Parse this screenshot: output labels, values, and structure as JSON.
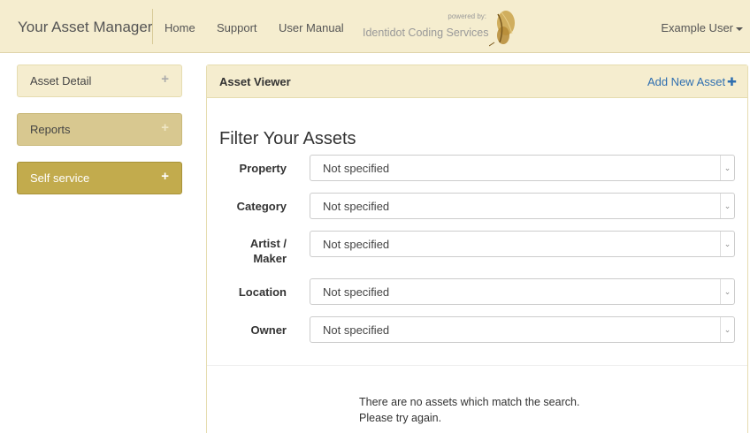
{
  "navbar": {
    "brand": "Your Asset Manager",
    "links": [
      "Home",
      "Support",
      "User Manual"
    ],
    "powered_by": "powered by:",
    "powered_name": "Identidot Coding Services",
    "user": "Example User"
  },
  "sidebar": {
    "items": [
      {
        "label": "Asset Detail",
        "icon": "plus-icon"
      },
      {
        "label": "Reports",
        "icon": "plus-icon"
      },
      {
        "label": "Self service",
        "icon": "plus-icon"
      }
    ]
  },
  "main": {
    "title": "Asset Viewer",
    "add_label": "Add New Asset",
    "filter_title": "Filter Your Assets",
    "filters": [
      {
        "label": "Property",
        "value": "Not specified"
      },
      {
        "label": "Category",
        "value": "Not specified"
      },
      {
        "label": "Artist /\nMaker",
        "value": "Not specified"
      },
      {
        "label": "Location",
        "value": "Not specified"
      },
      {
        "label": "Owner",
        "value": "Not specified"
      }
    ],
    "no_results_1": "There are no assets which match the search.",
    "no_results_2": "Please try again."
  },
  "colors": {
    "navbar_bg": "#f5edcf",
    "accent_gold": "#c2ab4d",
    "link_blue": "#2f6fb0"
  }
}
